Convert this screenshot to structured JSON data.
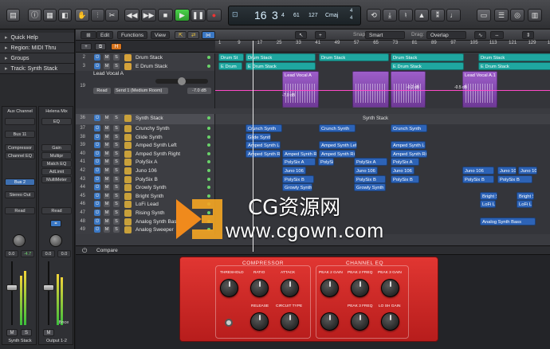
{
  "toolbar": {
    "lcd": {
      "bar": "16",
      "beat": "3",
      "division": "4",
      "tick": "61",
      "tempo": "127",
      "key": "Cmaj",
      "sig_top": "4",
      "sig_bottom": "4"
    }
  },
  "inspector": {
    "sections": [
      {
        "label": "Quick Help"
      },
      {
        "label": "Region: MIDI Thru"
      },
      {
        "label": "Groups"
      },
      {
        "label": "Track: Synth Stack"
      }
    ],
    "strip1": {
      "setting": "Aux Channel",
      "eq": "",
      "bus": "Bus 11",
      "plugins": [
        "Compressor",
        "Channel EQ"
      ],
      "send": "Bus 2",
      "output": "Stereo Out",
      "auto": "Read",
      "vol": "0.0",
      "peak": "-4.7",
      "name": "Synth Stack"
    },
    "strip2": {
      "setting": "Helena Mix",
      "eq": "EQ",
      "plugins": [
        "Gain",
        "Multipr",
        "Match EQ",
        "AdLimit",
        "MultiMeter"
      ],
      "auto": "Read",
      "vol": "0.0",
      "peak": "0.0",
      "bounce": "Bnce",
      "name": "Output 1-2"
    }
  },
  "arrange": {
    "menus": {
      "edit": "Edit",
      "functions": "Functions",
      "view": "View",
      "snap_label": "Snap:",
      "snap_value": "Smart",
      "drag_label": "Drag:",
      "drag_value": "Overlap"
    },
    "ruler": [
      "1",
      "9",
      "17",
      "25",
      "33",
      "41",
      "49",
      "57",
      "65",
      "73",
      "81",
      "89",
      "97",
      "105",
      "113",
      "121",
      "129",
      "137"
    ],
    "tracks": [
      {
        "num": "2",
        "name": "Drum Stack"
      },
      {
        "num": "3",
        "name": "E Drum Stack"
      },
      {
        "num": "19",
        "name": "Lead Vocal A"
      },
      {
        "num": "36",
        "name": "Synth Stack"
      },
      {
        "num": "37",
        "name": "Crunchy Synth"
      },
      {
        "num": "38",
        "name": "Glide Synth"
      },
      {
        "num": "39",
        "name": "Amped Synth Left"
      },
      {
        "num": "40",
        "name": "Amped Synth Right"
      },
      {
        "num": "41",
        "name": "PolySix A"
      },
      {
        "num": "42",
        "name": "Juno 106"
      },
      {
        "num": "43",
        "name": "PolySix B"
      },
      {
        "num": "44",
        "name": "Growly Synth"
      },
      {
        "num": "45",
        "name": "Bright Synth"
      },
      {
        "num": "46",
        "name": "LoFi Lead"
      },
      {
        "num": "47",
        "name": "Rising Synth"
      },
      {
        "num": "48",
        "name": "Analog Synth Bass"
      },
      {
        "num": "49",
        "name": "Analog Sweeper"
      }
    ],
    "vocal": {
      "mode": "Read",
      "send": "Send 1 (Medium Room)",
      "value": "-7.0 dB",
      "db_a": "-7.0 dB",
      "db_b": "-0.2 dB",
      "db_c": "-0.5 dB"
    },
    "stack_label": "Synth Stack",
    "regions": {
      "drum1": "Drum St",
      "drum2": "Drum Stack",
      "drum3": "Drum Stack",
      "drum4": "Drum Stack",
      "drum5": "Drum Stack",
      "edrum1": "E Drum",
      "edrum2": "E Drum Stack",
      "edrum3": "E Drum Stack",
      "edrum4": "E Drum Stack",
      "vocal1": "Lead Vocal A",
      "vocal2": "Lead Vocal A.1",
      "crunch1": "Crunch Synth",
      "crunch2": "Crunch Synth",
      "crunch3": "Crunch Synth",
      "glide1": "Glide Synth",
      "ampl1": "Amped Synth Left",
      "ampl2": "Amped Synth Left",
      "ampl3": "Amped Synth Left",
      "ampr1": "Amped Synth Right",
      "ampr2": "Amped Synth Right",
      "ampr3": "Amped Synth Right",
      "ampr4": "Amped Synth Right",
      "psa1": "PolySix A",
      "psa2": "PolySix",
      "psa3": "PolySix A",
      "psa4": "PolySix A",
      "juno1": "Juno 106",
      "juno2": "Juno 106",
      "juno3": "Juno 106",
      "juno4": "Juno 106",
      "juno5": "Juno 10",
      "psb1": "PolySix B",
      "psb2": "PolySix B",
      "psb3": "PolySix B",
      "psb4": "PolySix B",
      "psb5": "PolySix B",
      "growl1": "Growly Synth",
      "growl2": "Growly Synth",
      "bright1": "Bright S",
      "bright2": "Bright S",
      "lofi1": "LoFi Le",
      "lofi2": "LoFi Le",
      "bass1": "Analog Synth Bass"
    }
  },
  "plugin": {
    "compare": "Compare",
    "sections": {
      "compressor": "COMPRESSOR",
      "eq": "CHANNEL EQ"
    },
    "labels": {
      "threshold": "THRESHOLD",
      "ratio": "RATIO",
      "attack": "ATTACK",
      "release": "RELEASE",
      "circuit": "CIRCUIT TYPE",
      "peak2gain": "PEAK 2 GAIN",
      "peak2freq": "PEAK 2 FREQ",
      "peak3gain": "PEAK 3 GAIN",
      "peak3freq": "PEAK 3 FREQ",
      "loshgain": "LO SH GAIN"
    }
  },
  "watermark": {
    "cn": "CG资源网",
    "url": "www.cgown.com"
  },
  "colors": {
    "teal": "#1fa7a0",
    "blue": "#2d63b6",
    "purple": "#8a4fb5",
    "plugin_red": "#d42a28",
    "play_green": "#3dbd3d"
  }
}
